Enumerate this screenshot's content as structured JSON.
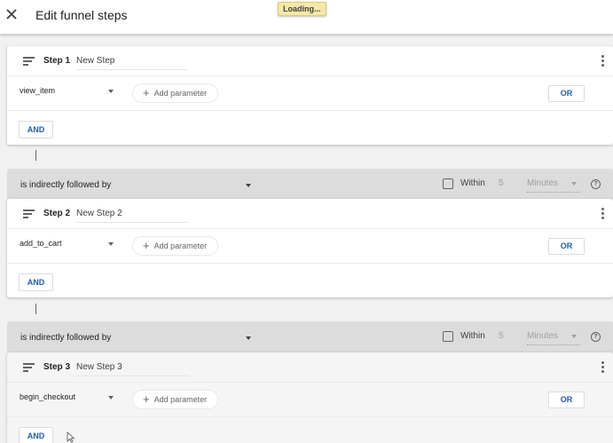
{
  "header": {
    "close_icon": "close-icon",
    "title": "Edit funnel steps",
    "loading": "Loading..."
  },
  "steps": [
    {
      "label": "Step 1",
      "name": "New Step",
      "event": "view_item",
      "add_param": "Add parameter",
      "or": "OR",
      "and": "AND"
    },
    {
      "label": "Step 2",
      "name": "New Step 2",
      "event": "add_to_cart",
      "add_param": "Add parameter",
      "or": "OR",
      "and": "AND"
    },
    {
      "label": "Step 3",
      "name": "New Step 3",
      "event": "begin_checkout",
      "add_param": "Add parameter",
      "or": "OR",
      "and": "AND"
    }
  ],
  "connectors": [
    {
      "relation": "is indirectly followed by",
      "within_label": "Within",
      "within_value": "5",
      "within_unit": "Minutes",
      "within_checked": false,
      "help": "?"
    },
    {
      "relation": "is indirectly followed by",
      "within_label": "Within",
      "within_value": "5",
      "within_unit": "Minutes",
      "within_checked": false,
      "help": "?"
    }
  ],
  "icons": {
    "plus": "+",
    "lines": "drag-lines-icon",
    "more": "more-vert-icon"
  },
  "colors": {
    "accent": "#1a5fb4",
    "loading_bg": "#f6e8a6"
  }
}
